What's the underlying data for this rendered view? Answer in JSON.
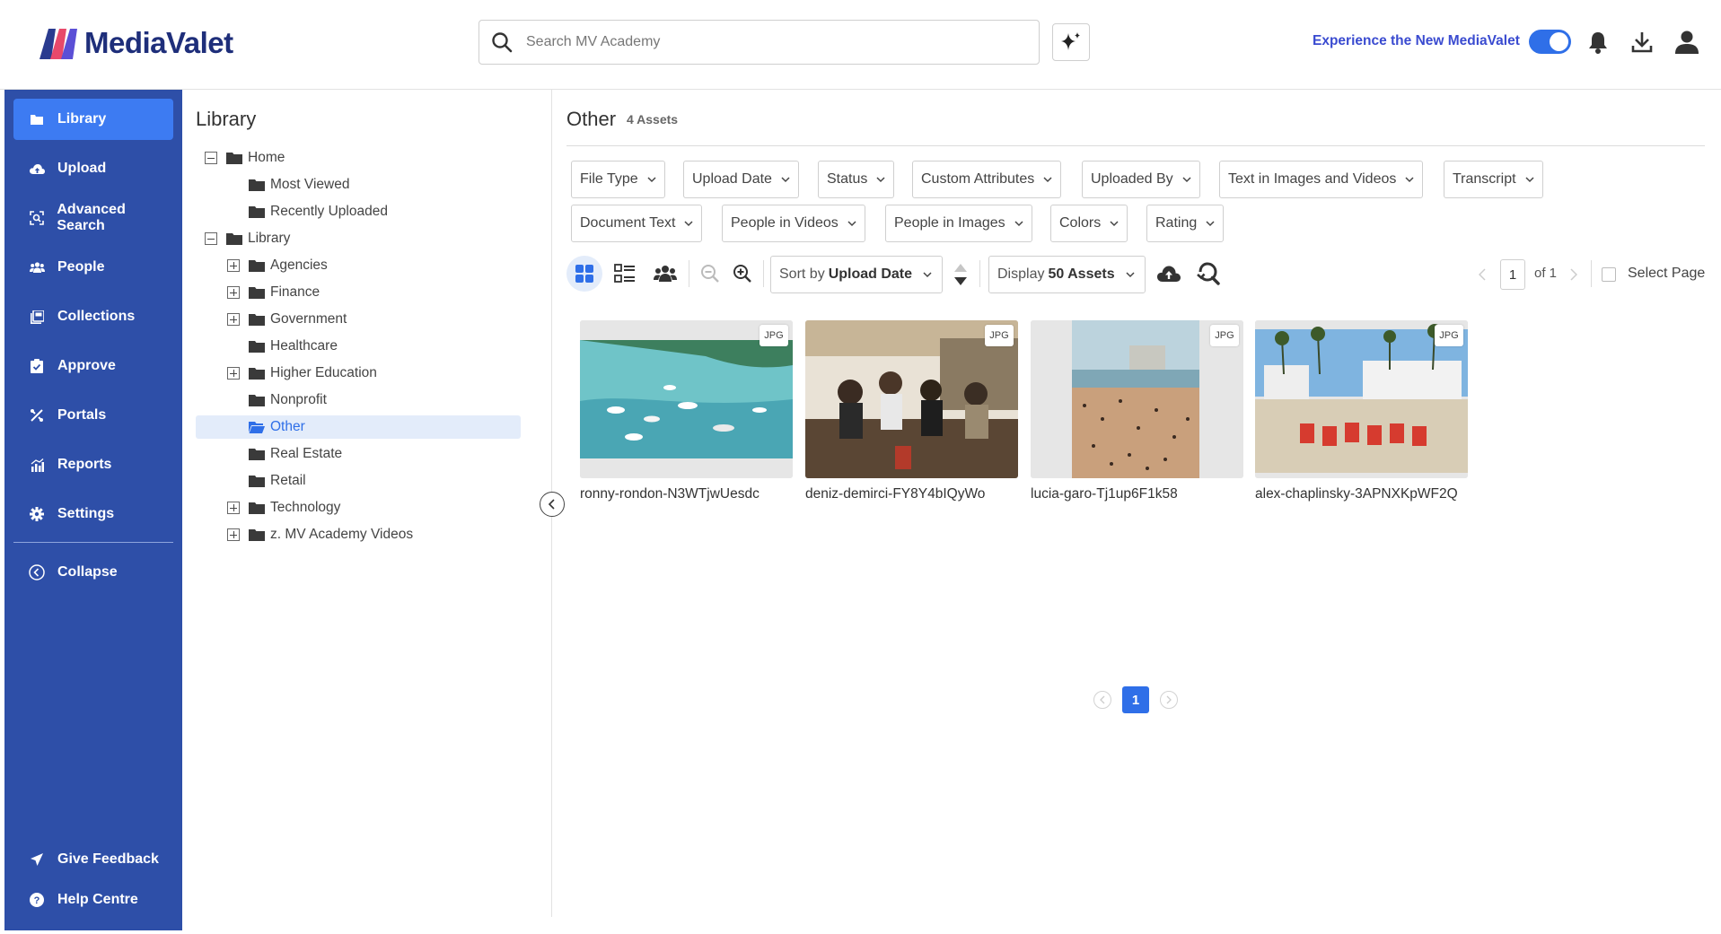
{
  "header": {
    "brand": "MediaValet",
    "search_placeholder": "Search MV Academy",
    "experience_link": "Experience the New MediaValet",
    "toggle_state": "on"
  },
  "sidebar": {
    "items": [
      {
        "label": "Library",
        "icon": "folder-icon",
        "active": true
      },
      {
        "label": "Upload",
        "icon": "cloud-upload-icon"
      },
      {
        "label": "Advanced Search",
        "icon": "advanced-search-icon"
      },
      {
        "label": "People",
        "icon": "people-icon"
      },
      {
        "label": "Collections",
        "icon": "collections-icon"
      },
      {
        "label": "Approve",
        "icon": "approve-icon"
      },
      {
        "label": "Portals",
        "icon": "portals-icon"
      },
      {
        "label": "Reports",
        "icon": "reports-icon"
      },
      {
        "label": "Settings",
        "icon": "gear-icon"
      }
    ],
    "collapse_label": "Collapse",
    "feedback_label": "Give Feedback",
    "help_label": "Help Centre"
  },
  "tree": {
    "title": "Library",
    "items": [
      {
        "label": "Home",
        "toggle": "minus",
        "level": 0
      },
      {
        "label": "Most Viewed",
        "toggle": "none",
        "level": 1
      },
      {
        "label": "Recently Uploaded",
        "toggle": "none",
        "level": 1
      },
      {
        "label": "Library",
        "toggle": "minus",
        "level": 0
      },
      {
        "label": "Agencies",
        "toggle": "plus",
        "level": 1
      },
      {
        "label": "Finance",
        "toggle": "plus",
        "level": 1
      },
      {
        "label": "Government",
        "toggle": "plus",
        "level": 1
      },
      {
        "label": "Healthcare",
        "toggle": "none",
        "level": 1
      },
      {
        "label": "Higher Education",
        "toggle": "plus",
        "level": 1
      },
      {
        "label": "Nonprofit",
        "toggle": "none",
        "level": 1
      },
      {
        "label": "Other",
        "toggle": "none",
        "level": 1,
        "selected": true
      },
      {
        "label": "Real Estate",
        "toggle": "none",
        "level": 1
      },
      {
        "label": "Retail",
        "toggle": "none",
        "level": 1
      },
      {
        "label": "Technology",
        "toggle": "plus",
        "level": 1
      },
      {
        "label": "z. MV Academy Videos",
        "toggle": "plus",
        "level": 1
      }
    ]
  },
  "main": {
    "title": "Other",
    "count": "4 Assets",
    "filters_row1": [
      "File Type",
      "Upload Date",
      "Status",
      "Custom Attributes",
      "Uploaded By",
      "Text in Images and Videos",
      "Transcript"
    ],
    "filters_row2": [
      "Document Text",
      "People in Videos",
      "People in Images",
      "Colors",
      "Rating"
    ],
    "sort_prefix": "Sort by",
    "sort_value": "Upload Date",
    "display_prefix": "Display",
    "display_value": "50 Assets",
    "page_current": "1",
    "page_of": "of 1",
    "select_page": "Select Page",
    "assets": [
      {
        "name": "ronny-rondon-N3WTjwUesdc",
        "type": "JPG"
      },
      {
        "name": "deniz-demirci-FY8Y4bIQyWo",
        "type": "JPG"
      },
      {
        "name": "lucia-garo-Tj1up6F1k58",
        "type": "JPG"
      },
      {
        "name": "alex-chaplinsky-3APNXKpWF2Q",
        "type": "JPG"
      }
    ],
    "bottom_page": "1"
  },
  "colors": {
    "sidebar_bg": "#2e4fa8",
    "active_nav": "#3d7bf2",
    "accent": "#2f6fe8"
  }
}
